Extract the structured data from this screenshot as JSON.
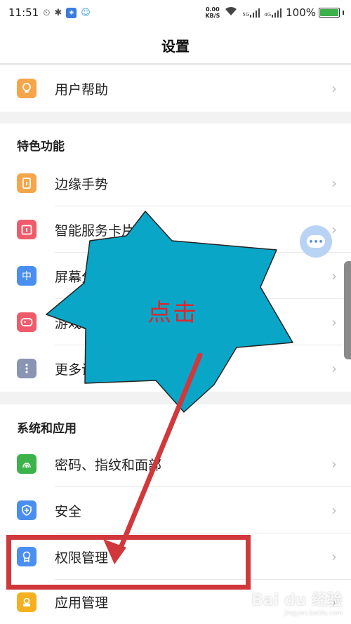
{
  "status_bar": {
    "time": "11:51",
    "net_speed_value": "0.00",
    "net_speed_unit": "KB/S",
    "signal1": "5G",
    "signal2": "4G",
    "battery_percent": "100%",
    "battery_level": 1.0,
    "battery_color": "#3cb24a"
  },
  "header": {
    "title": "设置"
  },
  "rows": {
    "help": {
      "label": "用户帮助",
      "icon": "lightbulb-icon",
      "color": "#f5a64a"
    },
    "gesture": {
      "label": "边缘手势",
      "icon": "edge-gesture-icon",
      "color": "#f5a64a"
    },
    "smart_card": {
      "label": "智能服务卡片",
      "icon": "calendar-card-icon",
      "color": "#ef5b6a"
    },
    "screen": {
      "label": "屏幕分屏",
      "icon": "split-screen-icon",
      "icon_text": "中",
      "color": "#4a8ff0"
    },
    "game": {
      "label": "游戏模式",
      "icon": "gamepad-icon",
      "color": "#ef5b6a"
    },
    "more": {
      "label": "更多设置",
      "icon": "more-vertical-icon",
      "color": "#8a95b5"
    },
    "password": {
      "label": "密码、指纹和面部",
      "icon": "fingerprint-icon",
      "color": "#3cb24a"
    },
    "security": {
      "label": "安全",
      "icon": "shield-icon",
      "color": "#4a8ff0"
    },
    "permission": {
      "label": "权限管理",
      "icon": "permission-badge-icon",
      "color": "#4a8ff0"
    },
    "apps": {
      "label": "应用管理",
      "icon": "app-manage-icon",
      "color": "#f5b020"
    }
  },
  "sections": {
    "features": {
      "title": "特色功能"
    },
    "system": {
      "title": "系统和应用"
    }
  },
  "chevron": "›",
  "annotation": {
    "text": "点击",
    "burst_color": "#0aa6c8",
    "text_color": "#e0262a",
    "arrow_color": "#d0383c"
  },
  "watermark": {
    "brand": "Bai du 经验",
    "url": "jingyan.baidu.com"
  }
}
